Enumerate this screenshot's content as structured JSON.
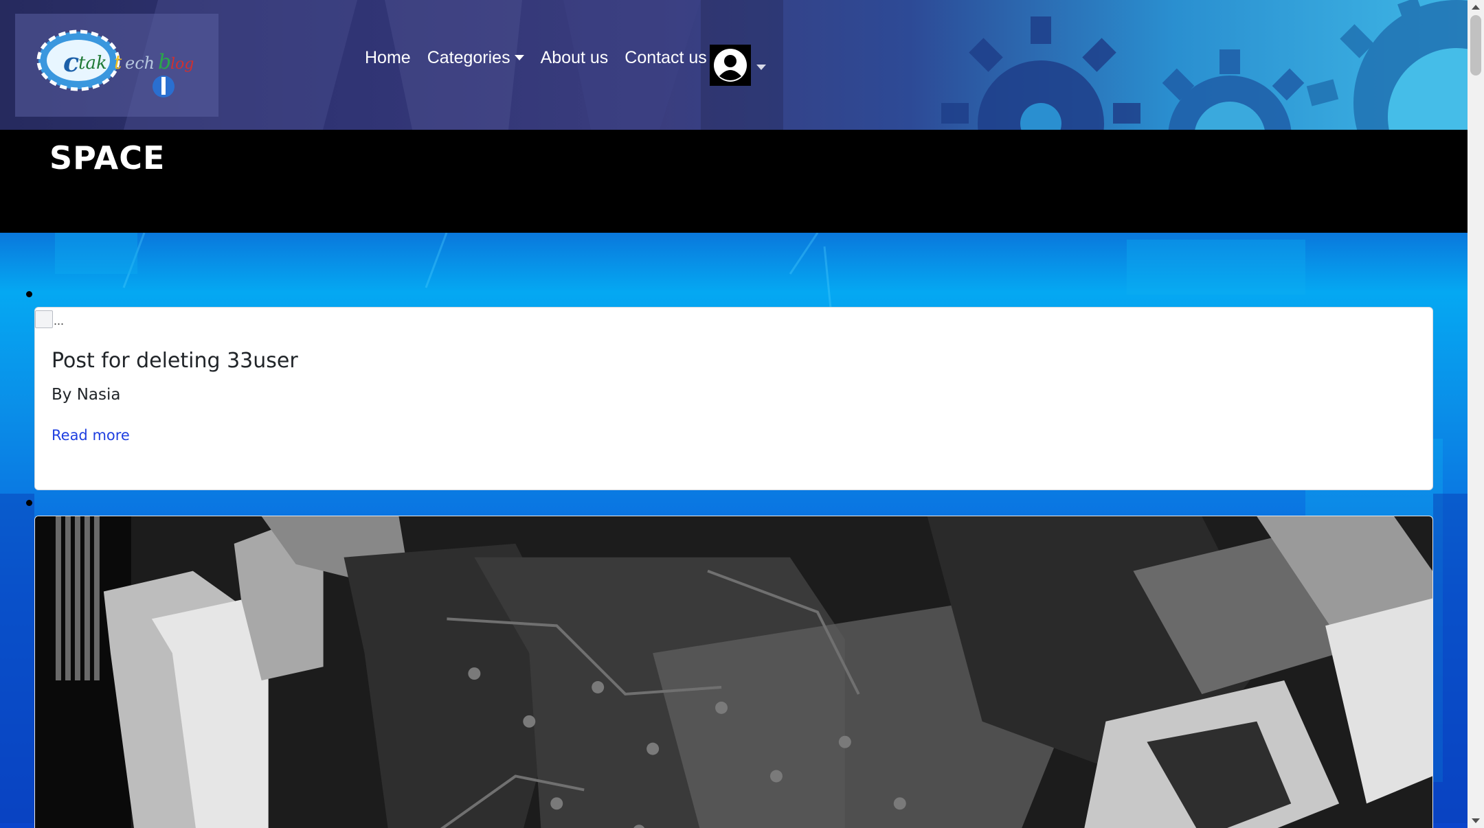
{
  "header": {
    "logo_text": "ctaktech blog",
    "nav": {
      "home": "Home",
      "categories": "Categories",
      "about": "About us",
      "contact": "Contact us"
    },
    "accent": "#2f3373"
  },
  "page": {
    "title": "SPACE"
  },
  "posts": [
    {
      "image_alt": "...",
      "title": "Post for deleting 33user",
      "author": "By Nasia",
      "link": "Read more"
    },
    {
      "image": "circuit-board-photo"
    }
  ],
  "colors": {
    "link": "#1f3fe0",
    "title_band": "#000000",
    "main_bg": "#0a78dc"
  }
}
